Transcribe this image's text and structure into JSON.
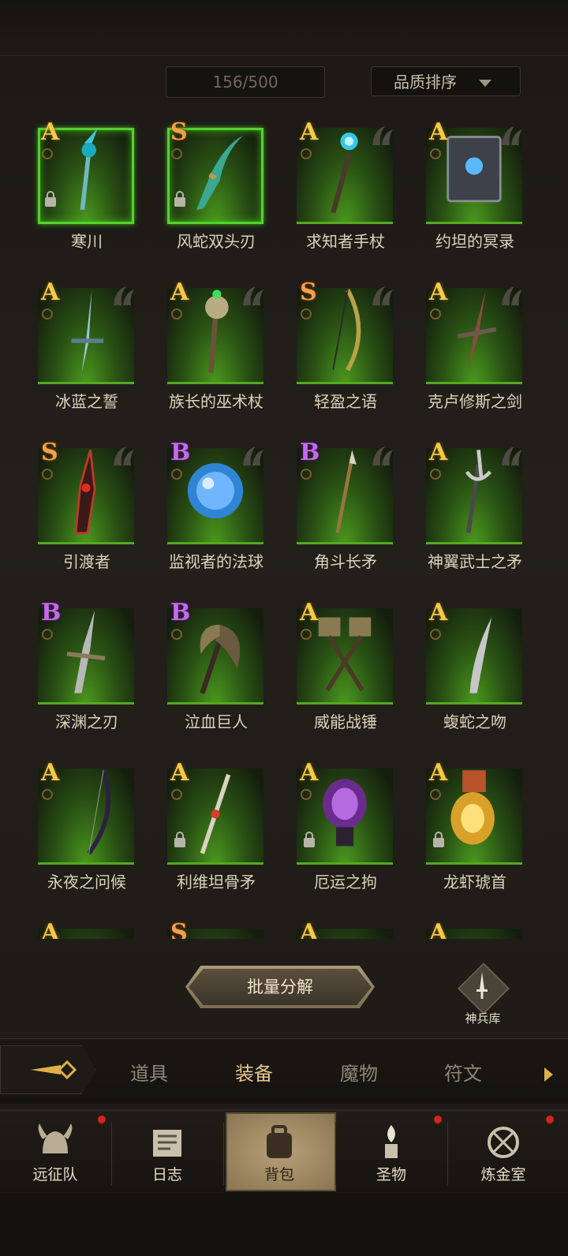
{
  "header": {
    "count": "156/500",
    "sort_label": "品质排序"
  },
  "items": [
    {
      "name": "寒川",
      "grade": "A",
      "locked": true,
      "selected": true,
      "art": "staff-ice",
      "hbadge": false
    },
    {
      "name": "风蛇双头刃",
      "grade": "S",
      "locked": true,
      "selected": true,
      "art": "blade-teal",
      "hbadge": false
    },
    {
      "name": "求知者手杖",
      "grade": "A",
      "locked": false,
      "selected": false,
      "art": "staff-orb",
      "hbadge": true
    },
    {
      "name": "约坦的冥录",
      "grade": "A",
      "locked": false,
      "selected": false,
      "art": "book",
      "hbadge": true
    },
    {
      "name": "冰蓝之誓",
      "grade": "A",
      "locked": false,
      "selected": false,
      "art": "sword-ice",
      "hbadge": true
    },
    {
      "name": "族长的巫术杖",
      "grade": "A",
      "locked": false,
      "selected": false,
      "art": "staff-skull",
      "hbadge": true
    },
    {
      "name": "轻盈之语",
      "grade": "S",
      "locked": false,
      "selected": false,
      "art": "bow",
      "hbadge": true
    },
    {
      "name": "克卢修斯之剑",
      "grade": "A",
      "locked": false,
      "selected": false,
      "art": "sword-red",
      "hbadge": true
    },
    {
      "name": "引渡者",
      "grade": "S",
      "locked": false,
      "selected": false,
      "art": "greatsword",
      "hbadge": true
    },
    {
      "name": "监视者的法球",
      "grade": "B",
      "locked": false,
      "selected": false,
      "art": "orb",
      "hbadge": true
    },
    {
      "name": "角斗长矛",
      "grade": "B",
      "locked": false,
      "selected": false,
      "art": "spear",
      "hbadge": true
    },
    {
      "name": "神翼武士之矛",
      "grade": "A",
      "locked": false,
      "selected": false,
      "art": "trident",
      "hbadge": true
    },
    {
      "name": "深渊之刃",
      "grade": "B",
      "locked": false,
      "selected": false,
      "art": "longsword",
      "hbadge": false
    },
    {
      "name": "泣血巨人",
      "grade": "B",
      "locked": false,
      "selected": false,
      "art": "axe",
      "hbadge": false
    },
    {
      "name": "威能战锤",
      "grade": "A",
      "locked": false,
      "selected": false,
      "art": "hammers",
      "hbadge": false
    },
    {
      "name": "蝮蛇之吻",
      "grade": "A",
      "locked": false,
      "selected": false,
      "art": "dagger",
      "hbadge": false
    },
    {
      "name": "永夜之问候",
      "grade": "A",
      "locked": false,
      "selected": false,
      "art": "bow-dark",
      "hbadge": false
    },
    {
      "name": "利维坦骨矛",
      "grade": "A",
      "locked": true,
      "selected": false,
      "art": "bone-spear",
      "hbadge": false
    },
    {
      "name": "厄运之拘",
      "grade": "A",
      "locked": true,
      "selected": false,
      "art": "gauntlet-purple",
      "hbadge": false
    },
    {
      "name": "龙虾琥首",
      "grade": "A",
      "locked": true,
      "selected": false,
      "art": "gauntlet-gold",
      "hbadge": false
    },
    {
      "name": "",
      "grade": "A",
      "locked": false,
      "selected": false,
      "art": "partial",
      "hbadge": false
    },
    {
      "name": "",
      "grade": "S",
      "locked": false,
      "selected": false,
      "art": "partial",
      "hbadge": false
    },
    {
      "name": "",
      "grade": "A",
      "locked": false,
      "selected": false,
      "art": "partial",
      "hbadge": false
    },
    {
      "name": "",
      "grade": "A",
      "locked": false,
      "selected": false,
      "art": "partial",
      "hbadge": false
    }
  ],
  "actions": {
    "dismantle_label": "批量分解",
    "armory_label": "神兵库"
  },
  "tabs": [
    {
      "label": "道具",
      "active": false
    },
    {
      "label": "装备",
      "active": true
    },
    {
      "label": "魔物",
      "active": false
    },
    {
      "label": "符文",
      "active": false
    }
  ],
  "nav": [
    {
      "label": "远征队",
      "icon": "helmet-icon",
      "dot": true,
      "active": false
    },
    {
      "label": "日志",
      "icon": "scroll-icon",
      "dot": false,
      "active": false
    },
    {
      "label": "背包",
      "icon": "backpack-icon",
      "dot": false,
      "active": true
    },
    {
      "label": "圣物",
      "icon": "relic-icon",
      "dot": true,
      "active": false
    },
    {
      "label": "炼金室",
      "icon": "alchemy-icon",
      "dot": true,
      "active": false
    }
  ],
  "colors": {
    "card_green": "#4c9a1e",
    "selected_border": "#54d22c",
    "grade_A": "#f2c94c",
    "grade_S": "#f2a04a",
    "grade_B": "#c46ae8",
    "notify_red": "#d8231d"
  }
}
